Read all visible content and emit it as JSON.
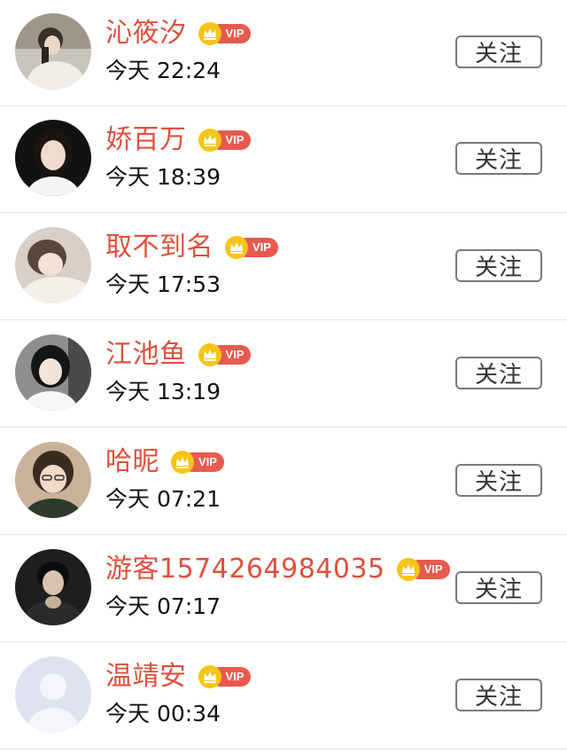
{
  "vip_label": "VIP",
  "follow_label": "关注",
  "colors": {
    "name": "#e0503c",
    "vip_bg": "#e85a4f",
    "crown": "#f5c518",
    "divider": "#e6e6e6"
  },
  "users": [
    {
      "name": "沁筱汐",
      "time": "今天 22:24"
    },
    {
      "name": "娇百万",
      "time": "今天 18:39"
    },
    {
      "name": "取不到名",
      "time": "今天 17:53"
    },
    {
      "name": "江池鱼",
      "time": "今天 13:19"
    },
    {
      "name": "哈昵",
      "time": "今天 07:21"
    },
    {
      "name": "游客1574264984035",
      "time": "今天 07:17"
    },
    {
      "name": "温靖安",
      "time": "今天 00:34"
    }
  ]
}
